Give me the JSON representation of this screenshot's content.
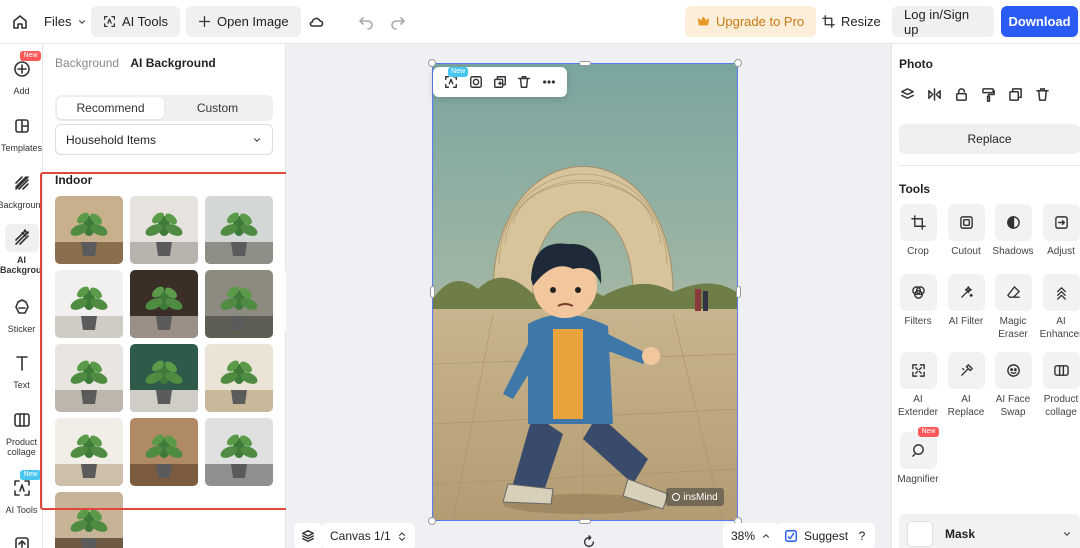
{
  "topbar": {
    "files_label": "Files",
    "ai_tools_label": "AI Tools",
    "open_image_label": "Open Image",
    "upgrade_label": "Upgrade to Pro",
    "resize_label": "Resize",
    "login_label": "Log in/Sign up",
    "download_label": "Download"
  },
  "rail": {
    "items": [
      {
        "label": "Add",
        "badge": "New"
      },
      {
        "label": "Templates"
      },
      {
        "label": "Background"
      },
      {
        "label": "AI Background",
        "active": true
      },
      {
        "label": "Sticker"
      },
      {
        "label": "Text"
      },
      {
        "label": "Product collage"
      },
      {
        "label": "AI Tools",
        "badge": "New"
      }
    ]
  },
  "panel": {
    "breadcrumb_parent": "Background",
    "breadcrumb_current": "AI Background",
    "tabs": [
      "Recommend",
      "Custom"
    ],
    "active_tab": "Recommend",
    "category_selected": "Household Items",
    "section_title": "Indoor",
    "thumbnail_count": 13
  },
  "canvas": {
    "floating_toolbar_badge": "New",
    "watermark": "insMind",
    "canvas_label": "Canvas 1/1",
    "zoom": "38%",
    "suggest_label": "Suggest",
    "help_label": "?"
  },
  "right_panel": {
    "photo_title": "Photo",
    "replace_label": "Replace",
    "tools_title": "Tools",
    "tools": [
      {
        "label": "Crop",
        "icon": "crop-icon"
      },
      {
        "label": "Cutout",
        "icon": "cutout-icon"
      },
      {
        "label": "Shadows",
        "icon": "shadows-icon"
      },
      {
        "label": "Adjust",
        "icon": "adjust-icon"
      },
      {
        "label": "Filters",
        "icon": "filters-icon"
      },
      {
        "label": "AI Filter",
        "icon": "ai-filter-icon"
      },
      {
        "label": "Magic Eraser",
        "icon": "eraser-icon"
      },
      {
        "label": "AI Enhancer",
        "icon": "enhancer-icon"
      },
      {
        "label": "AI Extender",
        "icon": "extender-icon"
      },
      {
        "label": "AI Replace",
        "icon": "replace-icon"
      },
      {
        "label": "AI Face Swap",
        "icon": "face-swap-icon"
      },
      {
        "label": "Product collage",
        "icon": "collage-icon"
      },
      {
        "label": "Magnifier",
        "icon": "magnifier-icon",
        "badge": "New"
      }
    ],
    "mask_label": "Mask"
  },
  "colors": {
    "accent": "#2a5bf5",
    "highlight": "#e0463a",
    "upgrade_text": "#c77a12"
  }
}
